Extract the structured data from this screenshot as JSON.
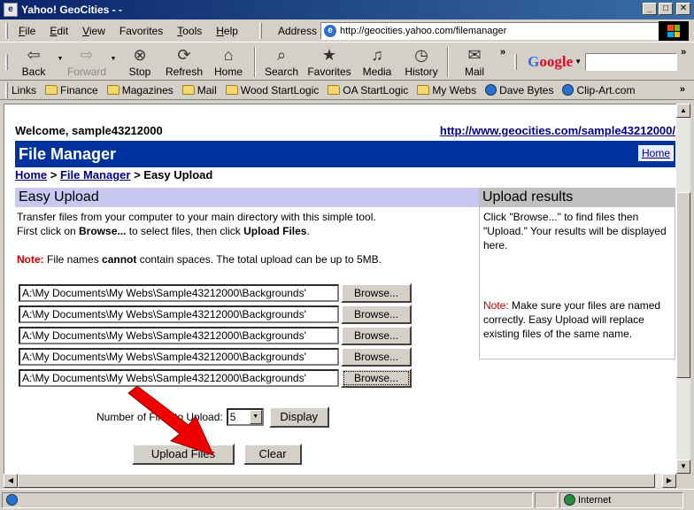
{
  "window": {
    "title": "Yahoo! GeoCities - -"
  },
  "menu": {
    "items": [
      {
        "u": "F",
        "rest": "ile"
      },
      {
        "u": "E",
        "rest": "dit"
      },
      {
        "u": "V",
        "rest": "iew"
      },
      {
        "u": "F",
        "rest": "avorites",
        "alt": "Favorites"
      },
      {
        "u": "T",
        "rest": "ools"
      },
      {
        "u": "H",
        "rest": "elp"
      }
    ],
    "address_label": "Address",
    "address_url": "http://geocities.yahoo.com/filemanager"
  },
  "toolbar": {
    "back": "Back",
    "forward": "Forward",
    "stop": "Stop",
    "refresh": "Refresh",
    "home": "Home",
    "search": "Search",
    "favorites": "Favorites",
    "media": "Media",
    "history": "History",
    "mail": "Mail",
    "google_prefix": "G",
    "google_rest": "oogle"
  },
  "links": {
    "label": "Links",
    "items": [
      "Finance",
      "Magazines",
      "Mail",
      "Wood StartLogic",
      "OA StartLogic",
      "My Webs",
      "Dave Bytes",
      "Clip-Art.com"
    ]
  },
  "page": {
    "welcome": "Welcome, sample43212000",
    "site_url": "http://www.geocities.com/sample43212000/",
    "fm_title": "File Manager",
    "home_button": "Home",
    "breadcrumb": {
      "home": "Home",
      "sep1": ">",
      "fm": "File Manager",
      "sep2": ">",
      "current": "Easy Upload"
    },
    "easy_upload_title": "Easy Upload",
    "desc_line1_a": "Transfer files from your computer to your main directory with this simple tool.",
    "desc_line2_a": "First click on ",
    "desc_line2_b": "Browse...",
    "desc_line2_c": " to select files, then click ",
    "desc_line2_d": "Upload Files",
    "desc_line2_e": ".",
    "note_label": "Note:",
    "note_a": " File names ",
    "note_b": "cannot",
    "note_c": " contain spaces. The total upload can be up to 5MB.",
    "upload_results_title": "Upload results",
    "results_text": "Click \"Browse...\" to find files then \"Upload.\" Your results will be displayed here.",
    "results_note_label": "Note:",
    "results_note_text": " Make sure your files are named correctly. Easy Upload will replace existing files of the same name.",
    "files": [
      "A:\\My Documents\\My Webs\\Sample43212000\\Backgrounds'",
      "A:\\My Documents\\My Webs\\Sample43212000\\Backgrounds'",
      "A:\\My Documents\\My Webs\\Sample43212000\\Backgrounds'",
      "A:\\My Documents\\My Webs\\Sample43212000\\Backgrounds'",
      "A:\\My Documents\\My Webs\\Sample43212000\\Backgrounds'"
    ],
    "browse_label": "Browse...",
    "count_label": "Number of Files to Upload:",
    "count_value": "5",
    "display_button": "Display",
    "upload_button": "Upload Files",
    "clear_button": "Clear"
  },
  "status": {
    "zone": "Internet"
  }
}
